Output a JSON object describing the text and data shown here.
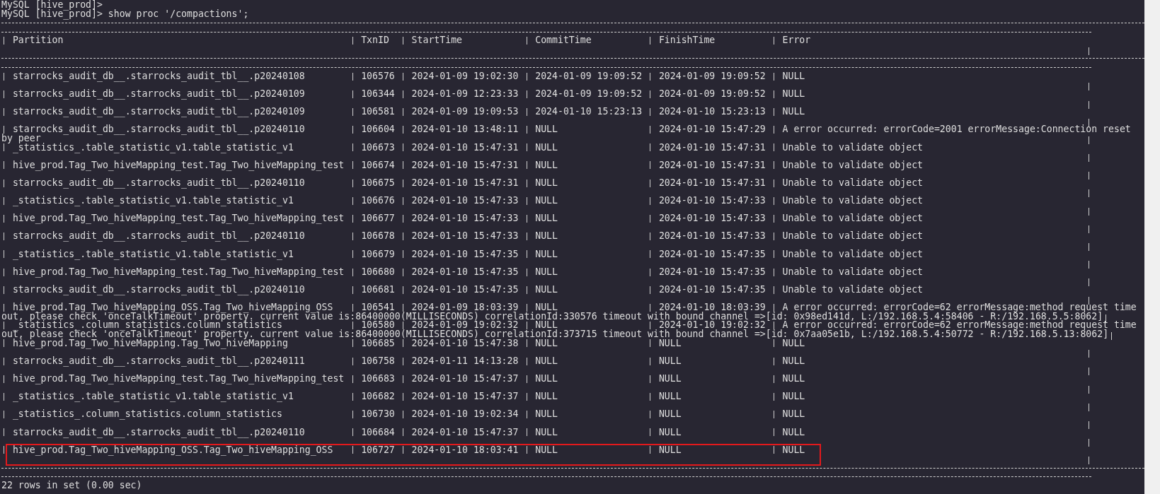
{
  "terminal": {
    "lines_before": [
      "MySQL [hive_prod]>",
      "MySQL [hive_prod]> show proc '/compactions';"
    ],
    "table": {
      "columns": [
        "Partition",
        "TxnID",
        "StartTime",
        "CommitTime",
        "FinishTime",
        "Error"
      ],
      "rows": [
        {
          "cells": [
            "starrocks_audit_db__.starrocks_audit_tbl__.p20240108",
            "106576",
            "2024-01-09 19:02:30",
            "2024-01-09 19:09:52",
            "2024-01-09 19:09:52",
            "NULL"
          ],
          "marked": false
        },
        {
          "cells": [
            "starrocks_audit_db__.starrocks_audit_tbl__.p20240109",
            "106344",
            "2024-01-09 12:23:33",
            "2024-01-09 19:09:52",
            "2024-01-09 19:09:52",
            "NULL"
          ],
          "marked": false
        },
        {
          "cells": [
            "starrocks_audit_db__.starrocks_audit_tbl__.p20240109",
            "106581",
            "2024-01-09 19:09:53",
            "2024-01-10 15:23:13",
            "2024-01-10 15:23:13",
            "NULL"
          ],
          "marked": false
        },
        {
          "cells": [
            "starrocks_audit_db__.starrocks_audit_tbl__.p20240110",
            "106604",
            "2024-01-10 13:48:11",
            "NULL",
            "2024-01-10 15:47:29",
            "A error occurred: errorCode=2001 errorMessage:Connection reset"
          ],
          "error_wrap": "by peer",
          "marked": false
        },
        {
          "cells": [
            "_statistics_.table_statistic_v1.table_statistic_v1",
            "106673",
            "2024-01-10 15:47:31",
            "NULL",
            "2024-01-10 15:47:31",
            "Unable to validate object"
          ],
          "marked": false
        },
        {
          "cells": [
            "hive_prod.Tag_Two_hiveMapping_test.Tag_Two_hiveMapping_test",
            "106674",
            "2024-01-10 15:47:31",
            "NULL",
            "2024-01-10 15:47:31",
            "Unable to validate object"
          ],
          "marked": false
        },
        {
          "cells": [
            "starrocks_audit_db__.starrocks_audit_tbl__.p20240110",
            "106675",
            "2024-01-10 15:47:31",
            "NULL",
            "2024-01-10 15:47:31",
            "Unable to validate object"
          ],
          "marked": false
        },
        {
          "cells": [
            "_statistics_.table_statistic_v1.table_statistic_v1",
            "106676",
            "2024-01-10 15:47:33",
            "NULL",
            "2024-01-10 15:47:33",
            "Unable to validate object"
          ],
          "marked": false
        },
        {
          "cells": [
            "hive_prod.Tag_Two_hiveMapping_test.Tag_Two_hiveMapping_test",
            "106677",
            "2024-01-10 15:47:33",
            "NULL",
            "2024-01-10 15:47:33",
            "Unable to validate object"
          ],
          "marked": false
        },
        {
          "cells": [
            "starrocks_audit_db__.starrocks_audit_tbl__.p20240110",
            "106678",
            "2024-01-10 15:47:33",
            "NULL",
            "2024-01-10 15:47:33",
            "Unable to validate object"
          ],
          "marked": false
        },
        {
          "cells": [
            "_statistics_.table_statistic_v1.table_statistic_v1",
            "106679",
            "2024-01-10 15:47:35",
            "NULL",
            "2024-01-10 15:47:35",
            "Unable to validate object"
          ],
          "marked": false
        },
        {
          "cells": [
            "hive_prod.Tag_Two_hiveMapping_test.Tag_Two_hiveMapping_test",
            "106680",
            "2024-01-10 15:47:35",
            "NULL",
            "2024-01-10 15:47:35",
            "Unable to validate object"
          ],
          "marked": false
        },
        {
          "cells": [
            "starrocks_audit_db__.starrocks_audit_tbl__.p20240110",
            "106681",
            "2024-01-10 15:47:35",
            "NULL",
            "2024-01-10 15:47:35",
            "Unable to validate object"
          ],
          "marked": false
        },
        {
          "cells": [
            "hive_prod.Tag_Two_hiveMapping_OSS.Tag_Two_hiveMapping_OSS",
            "106541",
            "2024-01-09 18:03:39",
            "NULL",
            "2024-01-10 18:03:39",
            "A error occurred: errorCode=62 errorMessage:method request time"
          ],
          "error_wrap": "out, please check 'onceTalkTimeout' property. current value is:86400000(MILLISECONDS) correlationId:330576 timeout with bound channel =>[id: 0x98ed141d, L:/192.168.5.4:58406 - R:/192.168.5.5:8062]",
          "marked": false
        },
        {
          "cells": [
            "_statistics_.column_statistics.column_statistics",
            "106580",
            "2024-01-09 19:02:32",
            "NULL",
            "2024-01-10 19:02:32",
            "A error occurred: errorCode=62 errorMessage:method request time"
          ],
          "error_wrap": "out, please check 'onceTalkTimeout' property. current value is:86400000(MILLISECONDS) correlationId:373715 timeout with bound channel =>[id: 0x7aa05e1b, L:/192.168.5.4:50772 - R:/192.168.5.13:8062]",
          "marked": false
        },
        {
          "cells": [
            "hive_prod.Tag_Two_hiveMapping.Tag_Two_hiveMapping",
            "106685",
            "2024-01-10 15:47:38",
            "NULL",
            "NULL",
            "NULL"
          ],
          "marked": false
        },
        {
          "cells": [
            "starrocks_audit_db__.starrocks_audit_tbl__.p20240111",
            "106758",
            "2024-01-11 14:13:28",
            "NULL",
            "NULL",
            "NULL"
          ],
          "marked": false
        },
        {
          "cells": [
            "hive_prod.Tag_Two_hiveMapping_test.Tag_Two_hiveMapping_test",
            "106683",
            "2024-01-10 15:47:37",
            "NULL",
            "NULL",
            "NULL"
          ],
          "marked": false
        },
        {
          "cells": [
            "_statistics_.table_statistic_v1.table_statistic_v1",
            "106682",
            "2024-01-10 15:47:37",
            "NULL",
            "NULL",
            "NULL"
          ],
          "marked": false
        },
        {
          "cells": [
            "_statistics_.column_statistics.column_statistics",
            "106730",
            "2024-01-10 19:02:34",
            "NULL",
            "NULL",
            "NULL"
          ],
          "marked": false
        },
        {
          "cells": [
            "starrocks_audit_db__.starrocks_audit_tbl__.p20240110",
            "106684",
            "2024-01-10 15:47:37",
            "NULL",
            "NULL",
            "NULL"
          ],
          "marked": false
        },
        {
          "cells": [
            "hive_prod.Tag_Two_hiveMapping_OSS.Tag_Two_hiveMapping_OSS",
            "106727",
            "2024-01-10 18:03:41",
            "NULL",
            "NULL",
            "NULL"
          ],
          "marked": true
        }
      ]
    },
    "footer": "22 rows in set (0.00 sec)"
  }
}
